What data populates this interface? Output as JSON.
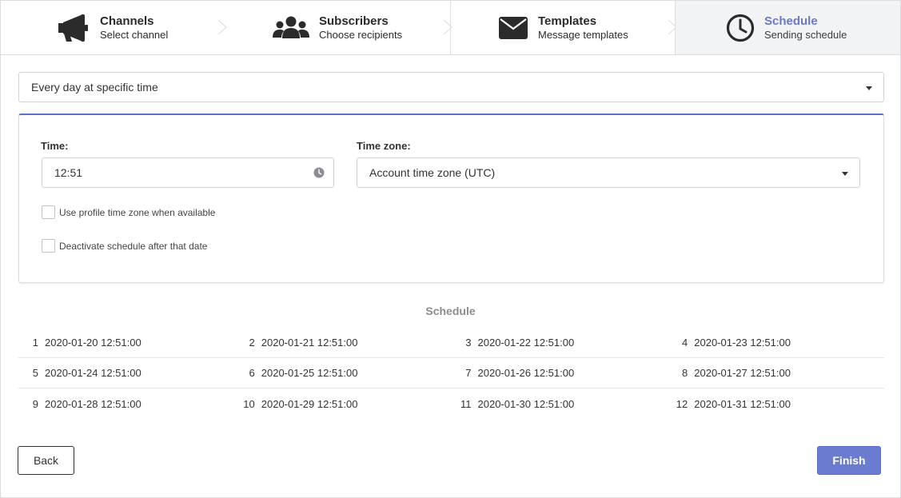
{
  "steps": [
    {
      "title": "Channels",
      "subtitle": "Select channel",
      "icon": "megaphone-icon"
    },
    {
      "title": "Subscribers",
      "subtitle": "Choose recipients",
      "icon": "users-icon"
    },
    {
      "title": "Templates",
      "subtitle": "Message templates",
      "icon": "envelope-icon"
    },
    {
      "title": "Schedule",
      "subtitle": "Sending schedule",
      "icon": "clock-icon",
      "active": true
    }
  ],
  "frequency": {
    "value": "Every day at specific time"
  },
  "settings": {
    "time_label": "Time:",
    "time_value": "12:51",
    "timezone_label": "Time zone:",
    "timezone_value": "Account time zone (UTC)",
    "use_profile_tz_label": "Use profile time zone when available",
    "use_profile_tz_checked": false,
    "deactivate_label": "Deactivate schedule after that date",
    "deactivate_checked": false
  },
  "schedule": {
    "title": "Schedule",
    "rows": [
      [
        {
          "n": "1",
          "dt": "2020-01-20 12:51:00"
        },
        {
          "n": "2",
          "dt": "2020-01-21 12:51:00"
        },
        {
          "n": "3",
          "dt": "2020-01-22 12:51:00"
        },
        {
          "n": "4",
          "dt": "2020-01-23 12:51:00"
        }
      ],
      [
        {
          "n": "5",
          "dt": "2020-01-24 12:51:00"
        },
        {
          "n": "6",
          "dt": "2020-01-25 12:51:00"
        },
        {
          "n": "7",
          "dt": "2020-01-26 12:51:00"
        },
        {
          "n": "8",
          "dt": "2020-01-27 12:51:00"
        }
      ],
      [
        {
          "n": "9",
          "dt": "2020-01-28 12:51:00"
        },
        {
          "n": "10",
          "dt": "2020-01-29 12:51:00"
        },
        {
          "n": "11",
          "dt": "2020-01-30 12:51:00"
        },
        {
          "n": "12",
          "dt": "2020-01-31 12:51:00"
        }
      ]
    ]
  },
  "buttons": {
    "back": "Back",
    "finish": "Finish"
  },
  "colors": {
    "accent": "#6b7bd0",
    "panel_top_border": "#5e6fc5",
    "active_step_bg": "#f2f3f5"
  }
}
